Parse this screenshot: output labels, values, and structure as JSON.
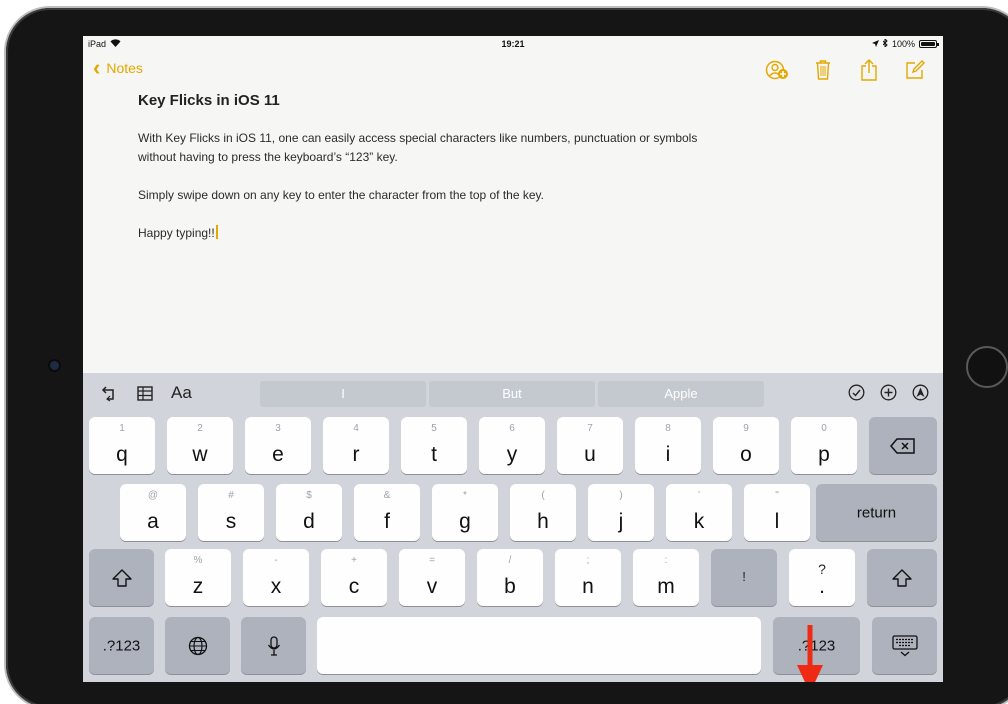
{
  "status": {
    "device": "iPad",
    "time": "19:21",
    "battery": "100%",
    "battery_level": 1.0
  },
  "nav": {
    "back_label": "Notes"
  },
  "note": {
    "title": "Key Flicks in iOS 11",
    "paragraphs": [
      "With Key Flicks in iOS 11, one can easily access special characters like numbers, punctuation or symbols without having to press the keyboard’s “123” key.",
      "Simply swipe down on any key to enter the character from the top of the key.",
      "Happy typing!!"
    ]
  },
  "toolbar": {
    "format_label": "Aa",
    "suggestions": [
      "I",
      "But",
      "Apple"
    ]
  },
  "keyboard": {
    "row1": [
      {
        "hint": "1",
        "main": "q"
      },
      {
        "hint": "2",
        "main": "w"
      },
      {
        "hint": "3",
        "main": "e"
      },
      {
        "hint": "4",
        "main": "r"
      },
      {
        "hint": "5",
        "main": "t"
      },
      {
        "hint": "6",
        "main": "y"
      },
      {
        "hint": "7",
        "main": "u"
      },
      {
        "hint": "8",
        "main": "i"
      },
      {
        "hint": "9",
        "main": "o"
      },
      {
        "hint": "0",
        "main": "p"
      }
    ],
    "row2": [
      {
        "hint": "@",
        "main": "a"
      },
      {
        "hint": "#",
        "main": "s"
      },
      {
        "hint": "$",
        "main": "d"
      },
      {
        "hint": "&",
        "main": "f"
      },
      {
        "hint": "*",
        "main": "g"
      },
      {
        "hint": "(",
        "main": "h"
      },
      {
        "hint": ")",
        "main": "j"
      },
      {
        "hint": "’",
        "main": "k"
      },
      {
        "hint": "\"",
        "main": "l"
      }
    ],
    "row3": [
      {
        "hint": "%",
        "main": "z"
      },
      {
        "hint": "-",
        "main": "x"
      },
      {
        "hint": "+",
        "main": "c"
      },
      {
        "hint": "=",
        "main": "v"
      },
      {
        "hint": "/",
        "main": "b"
      },
      {
        "hint": ";",
        "main": "n"
      },
      {
        "hint": ":",
        "main": "m"
      }
    ],
    "excl_key": "!",
    "question_key": {
      "hint": "?",
      "main": "."
    },
    "return_label": "return",
    "numbers_label": ".?123",
    "space_label": ""
  },
  "colors": {
    "accent": "#e5a800",
    "arrow": "#ee2a14"
  }
}
